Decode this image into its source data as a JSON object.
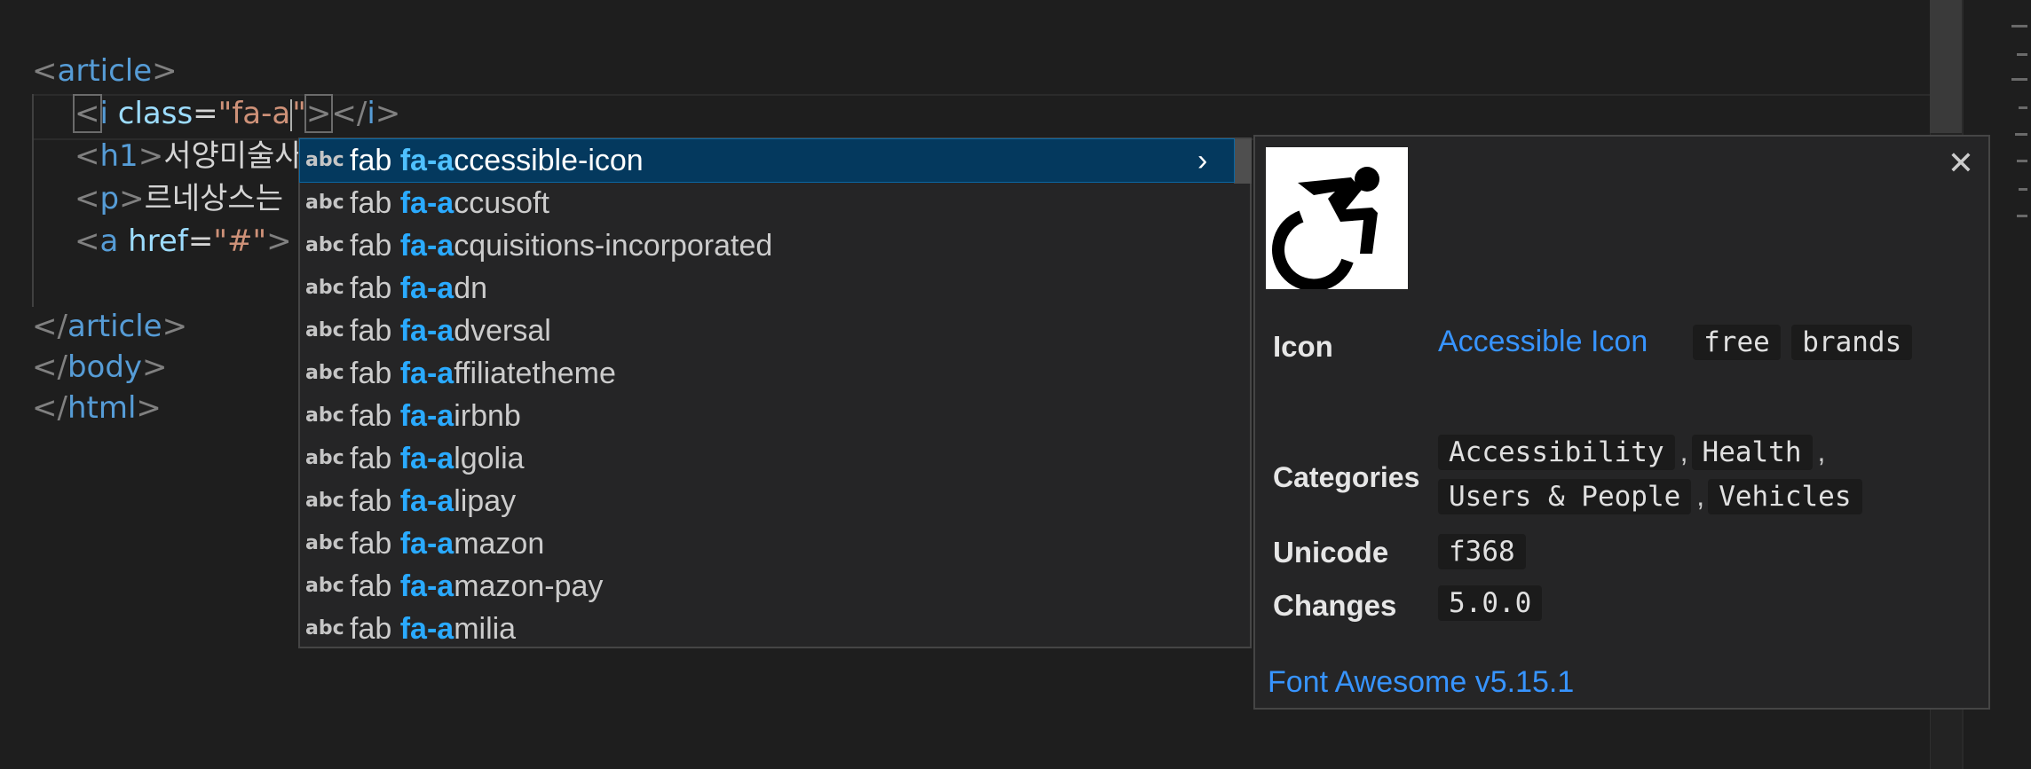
{
  "code": {
    "line1": {
      "open": "<",
      "tag": "article",
      "close": ">"
    },
    "line2": {
      "lt": "<",
      "tag": "i",
      "attr": "class",
      "eq": "=",
      "str_open": "\"fa-a",
      "str_close": "\"",
      "gt": ">",
      "close_lt": "</",
      "close_tag": "i",
      "close_gt": ">"
    },
    "line3": {
      "lt": "<",
      "tag": "h1",
      "gt": ">",
      "text": "서양미술사"
    },
    "line4": {
      "lt": "<",
      "tag": "p",
      "gt": ">",
      "text": "르네상스는"
    },
    "line5": {
      "lt": "<",
      "tag": "a",
      "attr": "href",
      "eq": "=",
      "str": "\"#\"",
      "gt": ">"
    },
    "line6": {
      "lt": "</",
      "tag": "article",
      "gt": ">"
    },
    "line7": {
      "lt": "</",
      "tag": "body",
      "gt": ">"
    },
    "line8": {
      "lt": "</",
      "tag": "html",
      "gt": ">"
    }
  },
  "suggest": {
    "kind_label": "abc",
    "items": [
      {
        "pre": "fab ",
        "hl": "fa-a",
        "rest": "ccessible-icon"
      },
      {
        "pre": "fab ",
        "hl": "fa-a",
        "rest": "ccusoft"
      },
      {
        "pre": "fab ",
        "hl": "fa-a",
        "rest": "cquisitions-incorporated"
      },
      {
        "pre": "fab ",
        "hl": "fa-a",
        "rest": "dn"
      },
      {
        "pre": "fab ",
        "hl": "fa-a",
        "rest": "dversal"
      },
      {
        "pre": "fab ",
        "hl": "fa-a",
        "rest": "ffiliatetheme"
      },
      {
        "pre": "fab ",
        "hl": "fa-a",
        "rest": "irbnb"
      },
      {
        "pre": "fab ",
        "hl": "fa-a",
        "rest": "lgolia"
      },
      {
        "pre": "fab ",
        "hl": "fa-a",
        "rest": "lipay"
      },
      {
        "pre": "fab ",
        "hl": "fa-a",
        "rest": "mazon"
      },
      {
        "pre": "fab ",
        "hl": "fa-a",
        "rest": "mazon-pay"
      },
      {
        "pre": "fab ",
        "hl": "fa-a",
        "rest": "milia"
      }
    ],
    "more_icon": "chevron-right-icon"
  },
  "detail": {
    "close_icon": "close-icon",
    "preview_icon": "accessible-icon",
    "icon_label": "Icon",
    "icon_name": "Accessible Icon",
    "icon_tags": [
      "free",
      "brands"
    ],
    "categories_label": "Categories",
    "categories_row1": [
      "Accessibility",
      "Health"
    ],
    "categories_row2": [
      "Users & People",
      "Vehicles"
    ],
    "unicode_label": "Unicode",
    "unicode_value": "f368",
    "changes_label": "Changes",
    "changes_value": "5.0.0",
    "footer": "Font Awesome v5.15.1"
  },
  "colors": {
    "selection": "#04395e",
    "match_highlight": "#2aaaff",
    "link": "#3794ff"
  }
}
